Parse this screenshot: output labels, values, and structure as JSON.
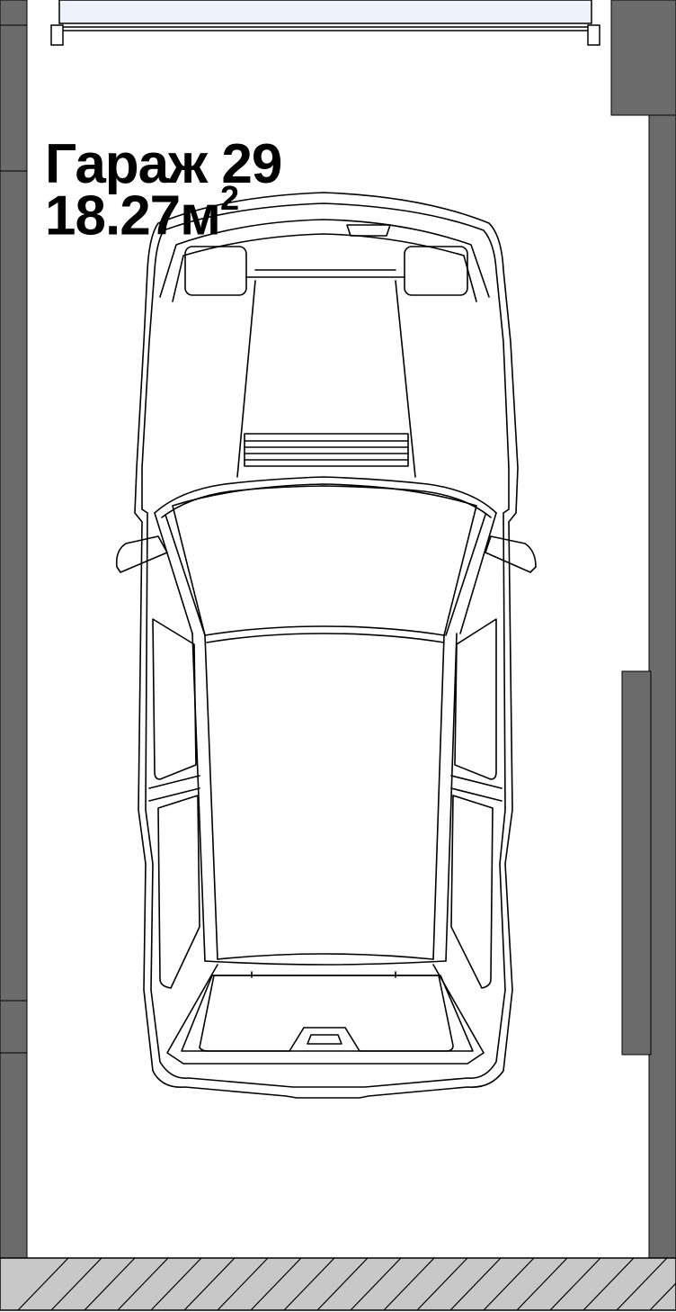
{
  "room": {
    "name": "Гараж 29",
    "area_value": "18.27м",
    "area_exponent": "2"
  },
  "colors": {
    "wall": "#6b6b6b",
    "floor": "#ffffff",
    "hatch_fill": "#c8c8c8",
    "line": "#000000"
  },
  "icons": {
    "car": "car-top-view-icon"
  }
}
